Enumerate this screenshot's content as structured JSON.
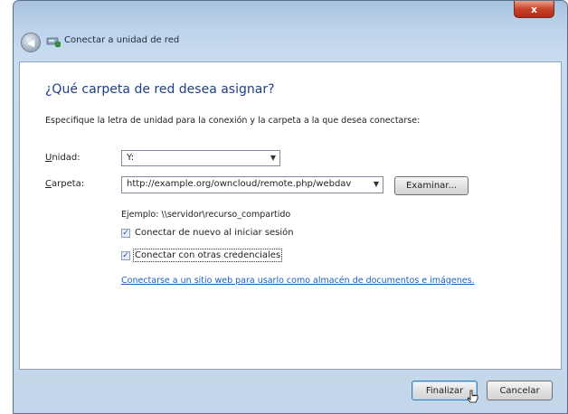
{
  "window": {
    "title": "Conectar a unidad de red",
    "close_glyph": "x"
  },
  "main": {
    "heading": "¿Qué carpeta de red desea asignar?",
    "description": "Especifique la letra de unidad para la conexión y la carpeta a la que desea conectarse:",
    "drive": {
      "label_prefix": "",
      "label_access": "U",
      "label_rest": "nidad:",
      "selected": "Y:"
    },
    "folder": {
      "label_access": "C",
      "label_rest": "arpeta:",
      "value": "http://example.org/owncloud/remote.php/webdav",
      "browse_label": "Examinar..."
    },
    "example": "Ejemplo: \\\\servidor\\recurso_compartido",
    "reconnect": {
      "label": "Conectar de nuevo al iniciar sesión",
      "checked": true
    },
    "other_credentials": {
      "label": "Conectar con otras credenciales",
      "checked": true
    },
    "website_link": "Conectarse a un sitio web para usarlo como almacén de documentos e imágenes."
  },
  "footer": {
    "finish_label": "Finalizar",
    "cancel_label": "Cancelar"
  },
  "icons": {
    "back": "back-arrow-icon",
    "title": "network-drive-icon",
    "dropdown": "chevron-down-icon"
  }
}
